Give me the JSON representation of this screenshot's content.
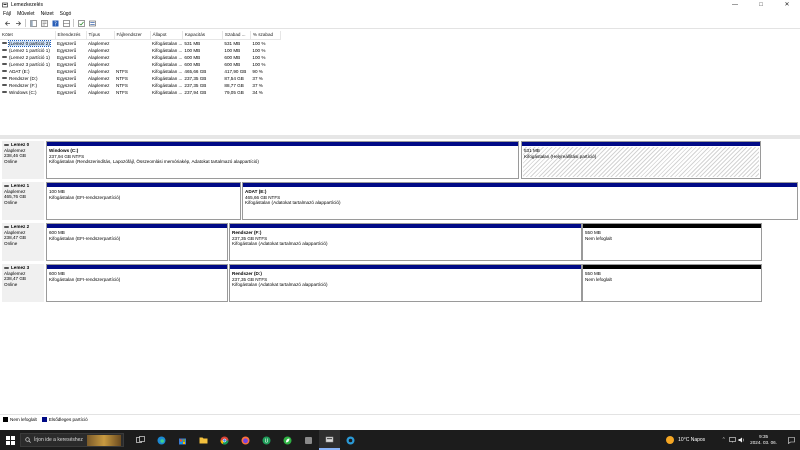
{
  "window": {
    "title": "Lemezkezelés",
    "minimize_glyph": "—",
    "maximize_glyph": "□",
    "close_glyph": "✕"
  },
  "menu": [
    "Fájl",
    "Művelet",
    "Nézet",
    "Súgó"
  ],
  "columns": [
    "Kötet",
    "Elrendezés",
    "Típus",
    "Fájlrendszer",
    "Állapot",
    "Kapacitás",
    "Szabad ...",
    "% szabad"
  ],
  "volumes": [
    [
      "(Lemez 0 partíció 2)",
      "Egyszerű",
      "Alaplemez",
      "",
      "Kifogástalan ...",
      "531 MB",
      "531 MB",
      "100 %"
    ],
    [
      "(Lemez 1 partíció 1)",
      "Egyszerű",
      "Alaplemez",
      "",
      "Kifogástalan ...",
      "100 MB",
      "100 MB",
      "100 %"
    ],
    [
      "(Lemez 2 partíció 1)",
      "Egyszerű",
      "Alaplemez",
      "",
      "Kifogástalan ...",
      "600 MB",
      "600 MB",
      "100 %"
    ],
    [
      "(Lemez 3 partíció 1)",
      "Egyszerű",
      "Alaplemez",
      "",
      "Kifogástalan ...",
      "600 MB",
      "600 MB",
      "100 %"
    ],
    [
      "ADAT (E:)",
      "Egyszerű",
      "Alaplemez",
      "NTFS",
      "Kifogástalan ...",
      "465,66 GB",
      "417,90 GB",
      "90 %"
    ],
    [
      "Rendszer (D:)",
      "Egyszerű",
      "Alaplemez",
      "NTFS",
      "Kifogástalan ...",
      "237,35 GB",
      "87,54 GB",
      "37 %"
    ],
    [
      "Rendszer (F:)",
      "Egyszerű",
      "Alaplemez",
      "NTFS",
      "Kifogástalan ...",
      "237,35 GB",
      "88,77 GB",
      "37 %"
    ],
    [
      "Windows (C:)",
      "Egyszerű",
      "Alaplemez",
      "NTFS",
      "Kifogástalan ...",
      "237,94 GB",
      "79,05 GB",
      "34 %"
    ]
  ],
  "disks": [
    {
      "name": "Lemez 0",
      "type": "Alaplemez",
      "size": "238,46 GB",
      "status": "Online",
      "partitions": [
        {
          "title": "Windows (C:)",
          "line1": "237,94 GB NTFS",
          "line2": "Kifogástalan (Rendszerindítás, Lapozófájl, Összeomlási memóriakép, Adatokat tartalmazó alappartíció)",
          "kind": "primary"
        },
        {
          "title": "",
          "line1": "531 MB",
          "line2": "Kifogástalan (Helyreállítási partíció)",
          "kind": "hatched"
        }
      ]
    },
    {
      "name": "Lemez 1",
      "type": "Alaplemez",
      "size": "465,76 GB",
      "status": "Online",
      "partitions": [
        {
          "title": "",
          "line1": "100 MB",
          "line2": "Kifogástalan (EFI-rendszerpartíció)",
          "kind": "primary"
        },
        {
          "title": "ADAT (E:)",
          "line1": "465,66 GB NTFS",
          "line2": "Kifogástalan (Adatokat tartalmazó alappartíció)",
          "kind": "primary"
        }
      ]
    },
    {
      "name": "Lemez 2",
      "type": "Alaplemez",
      "size": "238,47 GB",
      "status": "Online",
      "partitions": [
        {
          "title": "",
          "line1": "600 MB",
          "line2": "Kifogástalan (EFI-rendszerpartíció)",
          "kind": "primary"
        },
        {
          "title": "Rendszer (F:)",
          "line1": "237,35 GB NTFS",
          "line2": "Kifogástalan (Adatokat tartalmazó alappartíció)",
          "kind": "primary"
        },
        {
          "title": "",
          "line1": "550 MB",
          "line2": "Nem lefoglalt",
          "kind": "unallocated"
        }
      ]
    },
    {
      "name": "Lemez 3",
      "type": "Alaplemez",
      "size": "238,47 GB",
      "status": "Online",
      "partitions": [
        {
          "title": "",
          "line1": "600 MB",
          "line2": "Kifogástalan (EFI-rendszerpartíció)",
          "kind": "primary"
        },
        {
          "title": "Rendszer (D:)",
          "line1": "237,35 GB NTFS",
          "line2": "Kifogástalan (Adatokat tartalmazó alappartíció)",
          "kind": "primary"
        },
        {
          "title": "",
          "line1": "550 MB",
          "line2": "Nem lefoglalt",
          "kind": "unallocated"
        }
      ]
    }
  ],
  "legend": [
    {
      "label": "Nem lefoglalt",
      "color": "#000000"
    },
    {
      "label": "Elsődleges partíció",
      "color": "#000a86"
    }
  ],
  "taskbar": {
    "search_placeholder": "Írjon ide a kereséshez",
    "weather_text": "10°C  Napos",
    "time": "9:35",
    "date": "2024. 03. 06."
  }
}
